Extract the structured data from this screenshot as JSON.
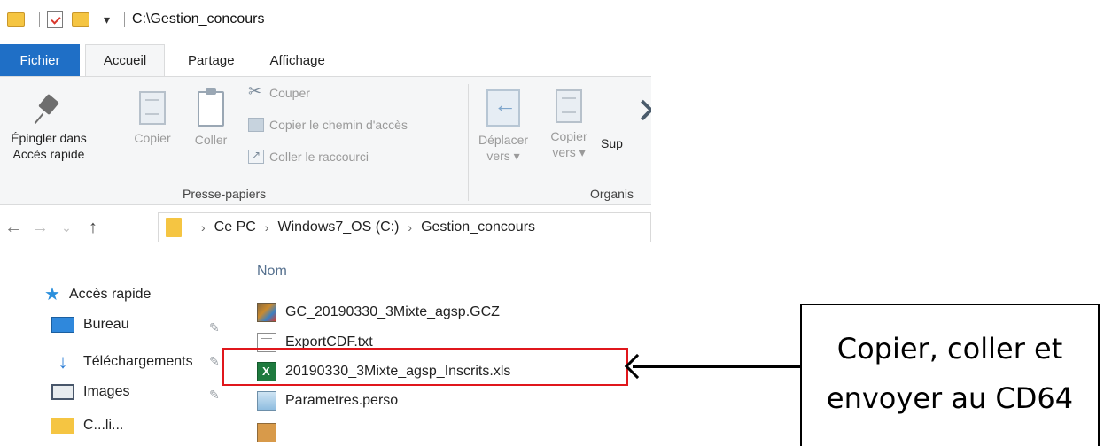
{
  "window": {
    "title_path": "C:\\Gestion_concours"
  },
  "ribbon": {
    "tabs": [
      {
        "label": "Fichier"
      },
      {
        "label": "Accueil"
      },
      {
        "label": "Partage"
      },
      {
        "label": "Affichage"
      }
    ],
    "pin_label_1": "Épingler dans",
    "pin_label_2": "Accès rapide",
    "copy_label": "Copier",
    "paste_label": "Coller",
    "cut_label": "Couper",
    "copy_path_label": "Copier le chemin d'accès",
    "paste_shortcut_label": "Coller le raccourci",
    "clipboard_group": "Presse-papiers",
    "move_label_1": "Déplacer",
    "move_label_2": "vers ▾",
    "copyto_label_1": "Copier",
    "copyto_label_2": "vers ▾",
    "delete_label": "Sup",
    "organize_group": "Organis"
  },
  "address": {
    "crumbs": [
      "Ce PC",
      "Windows7_OS (C:)",
      "Gestion_concours"
    ]
  },
  "navpane": {
    "items": [
      {
        "label": "Accès rapide",
        "icon": "star-icon"
      },
      {
        "label": "Bureau",
        "icon": "desktop-icon"
      },
      {
        "label": "Téléchargements",
        "icon": "download-icon"
      },
      {
        "label": "Images",
        "icon": "images-icon"
      },
      {
        "label": "C...li...",
        "icon": "folder-icon"
      }
    ]
  },
  "filelist": {
    "column_name": "Nom",
    "files": [
      {
        "name": "GC_20190330_3Mixte_agsp.GCZ",
        "icon": "gcz-file-icon"
      },
      {
        "name": "ExportCDF.txt",
        "icon": "text-file-icon"
      },
      {
        "name": "20190330_3Mixte_agsp_Inscrits.xls",
        "icon": "excel-file-icon"
      },
      {
        "name": "Parametres.perso",
        "icon": "perso-file-icon"
      }
    ]
  },
  "callout": {
    "text": "Copier, coller et\nenvoyer au CD64"
  },
  "colors": {
    "file_tab": "#1f6fc6",
    "highlight_border": "#e0171c",
    "folder": "#f5c542"
  }
}
